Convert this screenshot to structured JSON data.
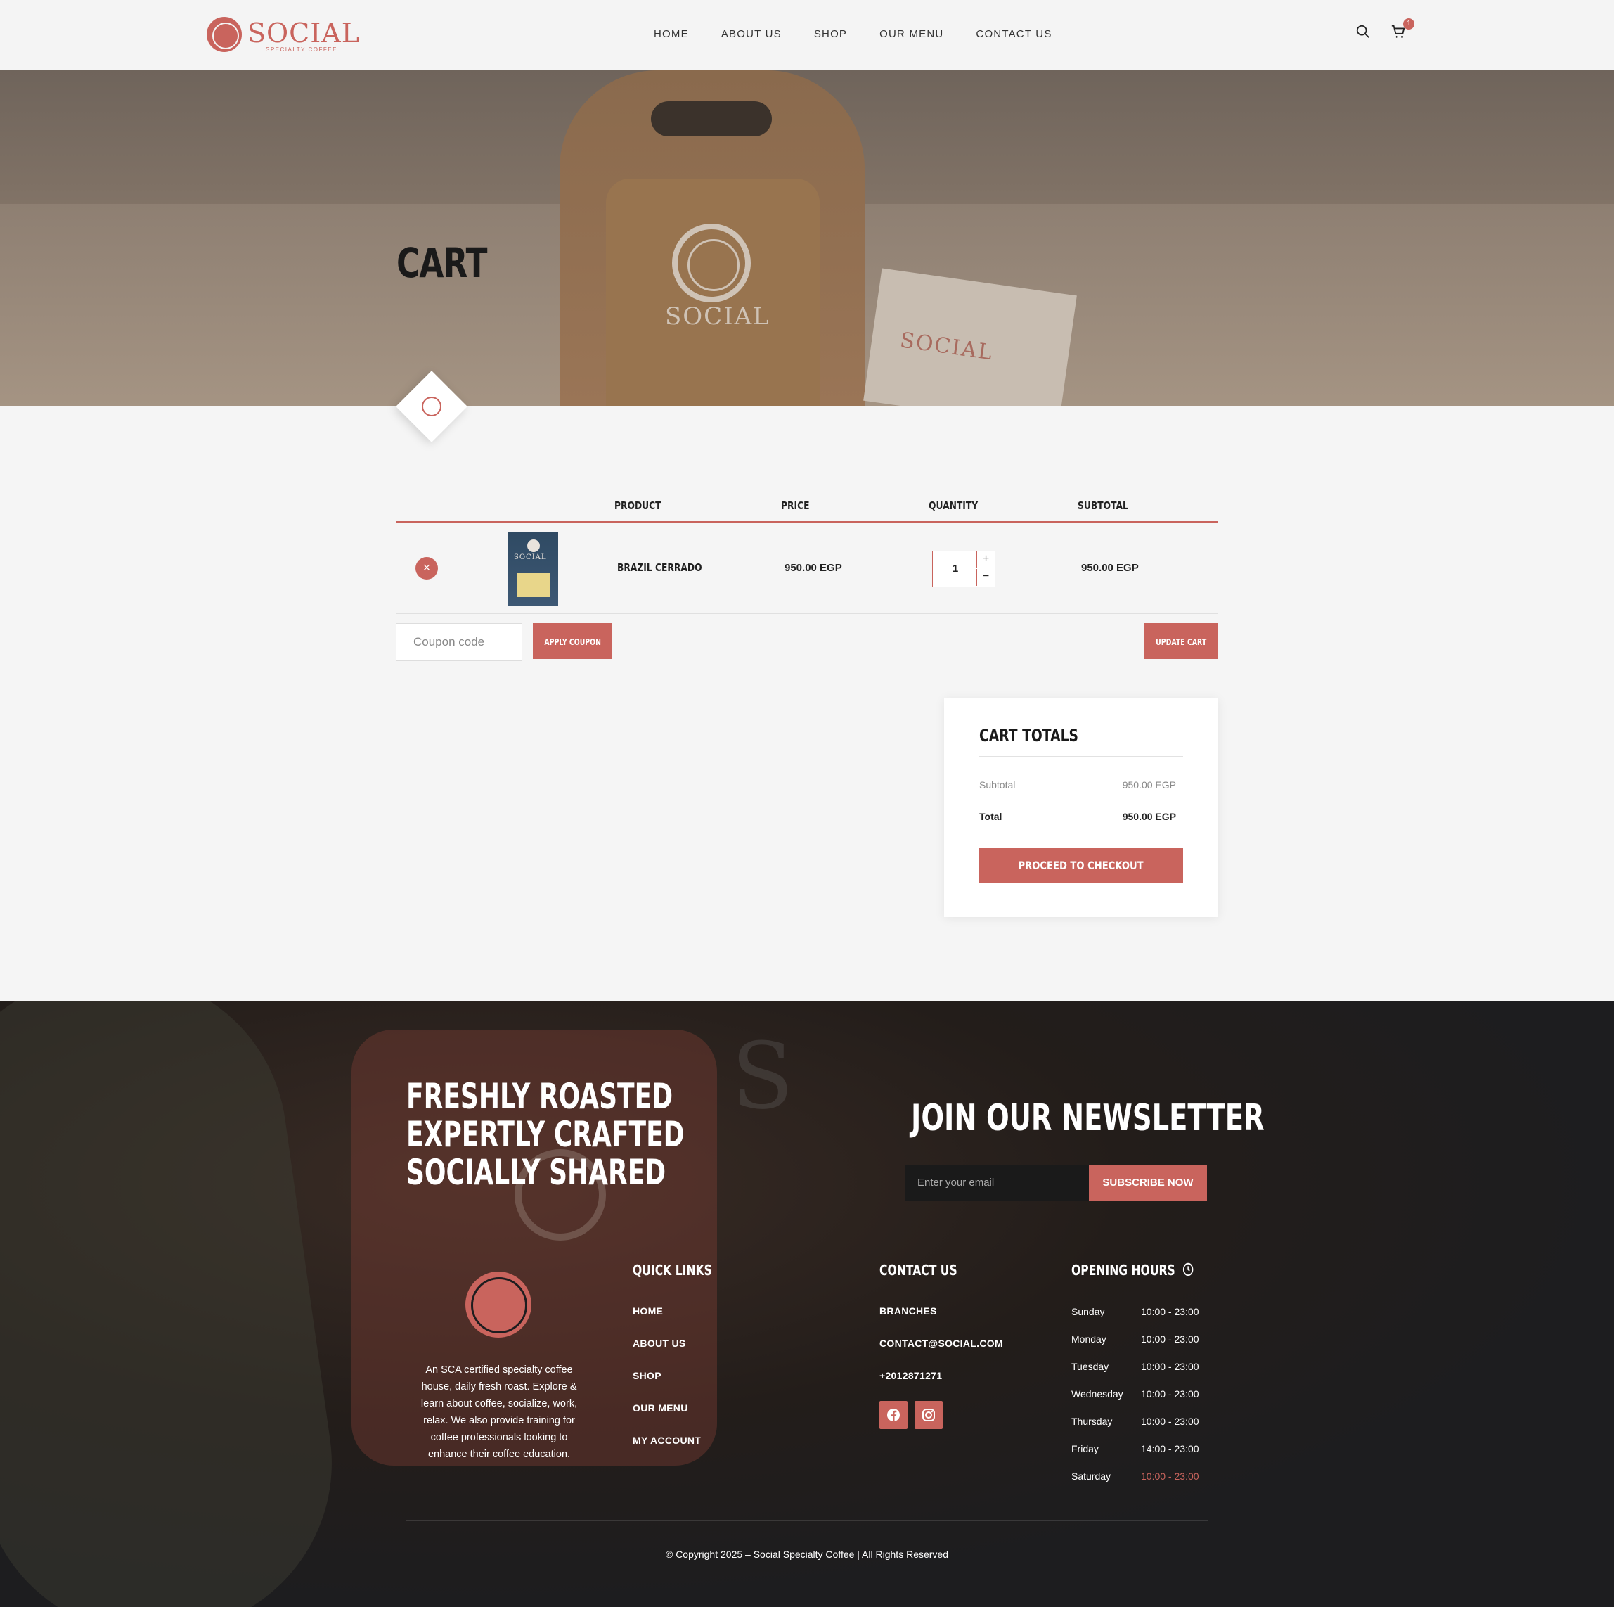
{
  "brand": {
    "name": "SOCIAL",
    "tagline": "SPECIALTY COFFEE"
  },
  "nav": {
    "items": [
      "HOME",
      "ABOUT US",
      "SHOP",
      "OUR MENU",
      "CONTACT US"
    ]
  },
  "header": {
    "cart_count": "1"
  },
  "hero": {
    "title": "CART",
    "bag_text": "SOCIAL",
    "paper_text": "SOCIAL"
  },
  "cart": {
    "columns": {
      "product": "PRODUCT",
      "price": "PRICE",
      "quantity": "QUANTITY",
      "subtotal": "SUBTOTAL"
    },
    "items": [
      {
        "name": "BRAZIL CERRADO",
        "price": "950.00 EGP",
        "quantity": "1",
        "subtotal": "950.00 EGP",
        "thumb_text": "SOCIAL"
      }
    ],
    "coupon_placeholder": "Coupon code",
    "apply_label": "APPLY COUPON",
    "update_label": "UPDATE CART",
    "remove_glyph": "×",
    "plus_glyph": "+",
    "minus_glyph": "−"
  },
  "totals": {
    "title": "CART TOTALS",
    "subtotal_label": "Subtotal",
    "subtotal_value": "950.00 EGP",
    "total_label": "Total",
    "total_value": "950.00 EGP",
    "checkout_label": "PROCEED TO CHECKOUT"
  },
  "footer": {
    "slogan": [
      "FRESHLY ROASTED",
      "EXPERTLY CRAFTED",
      "SOCIALLY SHARED"
    ],
    "newsletter_title": "JOIN OUR NEWSLETTER",
    "email_placeholder": "Enter your email",
    "subscribe_label": "SUBSCRIBE NOW",
    "about": "An SCA certified specialty coffee house, daily fresh roast. Explore & learn about coffee, socialize, work, relax. We also provide training for coffee professionals looking to enhance their coffee education.",
    "quick_links_title": "QUICK LINKS",
    "quick_links": [
      "HOME",
      "ABOUT US",
      "SHOP",
      "OUR MENU",
      "MY ACCOUNT"
    ],
    "contact_title": "CONTACT US",
    "contact": [
      "BRANCHES",
      "CONTACT@SOCIAL.COM",
      "+2012871271"
    ],
    "hours_title": "OPENING HOURS",
    "hours": [
      {
        "day": "Sunday",
        "time": "10:00 - 23:00"
      },
      {
        "day": "Monday",
        "time": "10:00 - 23:00"
      },
      {
        "day": "Tuesday",
        "time": "10:00 - 23:00"
      },
      {
        "day": "Wednesday",
        "time": "10:00 - 23:00"
      },
      {
        "day": "Thursday",
        "time": "10:00 - 23:00"
      },
      {
        "day": "Friday",
        "time": "14:00 - 23:00"
      },
      {
        "day": "Saturday",
        "time": "10:00 - 23:00"
      }
    ],
    "copyright": "© Copyright 2025 – Social Specialty Coffee | All Rights Reserved"
  },
  "colors": {
    "accent": "#c9645d",
    "today_highlight": "#c9645d"
  }
}
